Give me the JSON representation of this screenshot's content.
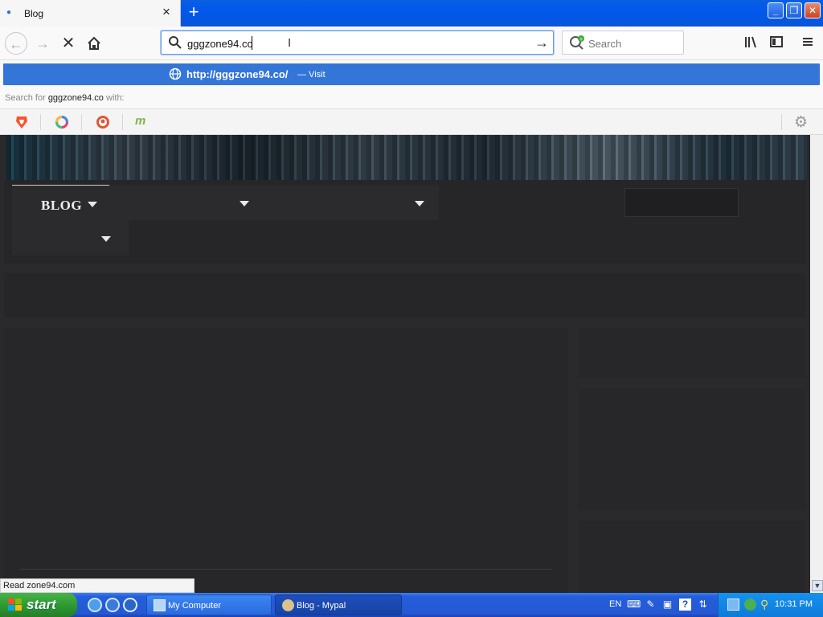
{
  "browser": {
    "tab": {
      "title": "Blog"
    },
    "window_buttons": {
      "minimize": "_",
      "maximize": "❐",
      "close": "✕"
    },
    "urlbar": {
      "value": "gggzone94.co"
    },
    "search": {
      "placeholder": "Search"
    },
    "suggestion": {
      "url": "http://gggzone94.co/",
      "action": "— Visit"
    },
    "search_for": {
      "prefix": "Search for",
      "query": "gggzone94.co",
      "suffix": "with:"
    },
    "engines": [
      "brave-icon",
      "qwant-icon",
      "duckduckgo-icon",
      "mojeek-icon"
    ],
    "status": "Read zone94.com"
  },
  "site": {
    "nav": {
      "items": [
        {
          "label": "BLOG"
        },
        {
          "label": ""
        },
        {
          "label": ""
        },
        {
          "label": ""
        }
      ]
    }
  },
  "taskbar": {
    "start_label": "start",
    "tasks": [
      {
        "label": "My Computer"
      },
      {
        "label": "Blog - Mypal"
      }
    ],
    "language": "EN",
    "clock": "10:31 PM"
  },
  "colors": {
    "accent": "#3475d8",
    "page_bg": "#2a2a2c",
    "taskbar": "#245edb",
    "start": "#2f9a31"
  }
}
